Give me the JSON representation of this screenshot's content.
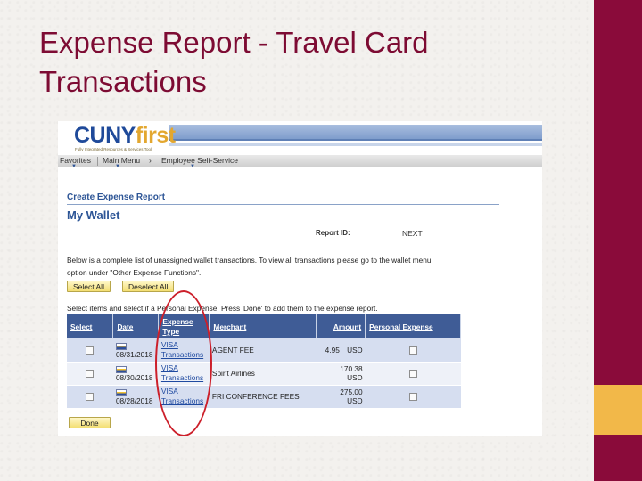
{
  "slide": {
    "title_line1": "Expense Report - Travel Card",
    "title_line2": "Transactions"
  },
  "colors": {
    "maroon": "#8a0b3a",
    "gold": "#f2b849",
    "header_blue": "#3f5c96",
    "link_blue": "#1f4aa0",
    "annotation": "#cc1f2a"
  },
  "brand": {
    "cuny": "CUNY",
    "first": "first",
    "tagline": "Fully Integrated Resources & Services Tool"
  },
  "nav": {
    "favorites": "Favorites",
    "main_menu": "Main Menu",
    "arrow": "›",
    "employee_self_service": "Employee Self-Service"
  },
  "page": {
    "heading": "Create Expense Report",
    "title": "My Wallet",
    "report_id_label": "Report ID:",
    "report_id_value": "NEXT",
    "info_text": "Below is a complete list of unassigned wallet transactions. To view all transactions please go to the wallet menu option under \"Other Expense Functions\".",
    "select_all": "Select All",
    "deselect_all": "Deselect All",
    "select_instructions": "Select items and select if a Personal Expense. Press 'Done' to add them to the expense report.",
    "done": "Done"
  },
  "table": {
    "headers": {
      "select": "Select",
      "date": "Date",
      "expense_type": "Expense Type",
      "merchant": "Merchant",
      "amount": "Amount",
      "personal_expense": "Personal Expense"
    },
    "rows": [
      {
        "date": "08/31/2018",
        "type_line1": "VISA",
        "type_line2": "Transactions",
        "merchant": "AGENT FEE",
        "amount": "4.95",
        "currency": "USD"
      },
      {
        "date": "08/30/2018",
        "type_line1": "VISA",
        "type_line2": "Transactions",
        "merchant": "Spirit Airlines",
        "amount": "170.38",
        "currency": "USD"
      },
      {
        "date": "08/28/2018",
        "type_line1": "VISA",
        "type_line2": "Transactions",
        "merchant": "FRI CONFERENCE FEES",
        "amount": "275.00",
        "currency": "USD"
      }
    ]
  }
}
